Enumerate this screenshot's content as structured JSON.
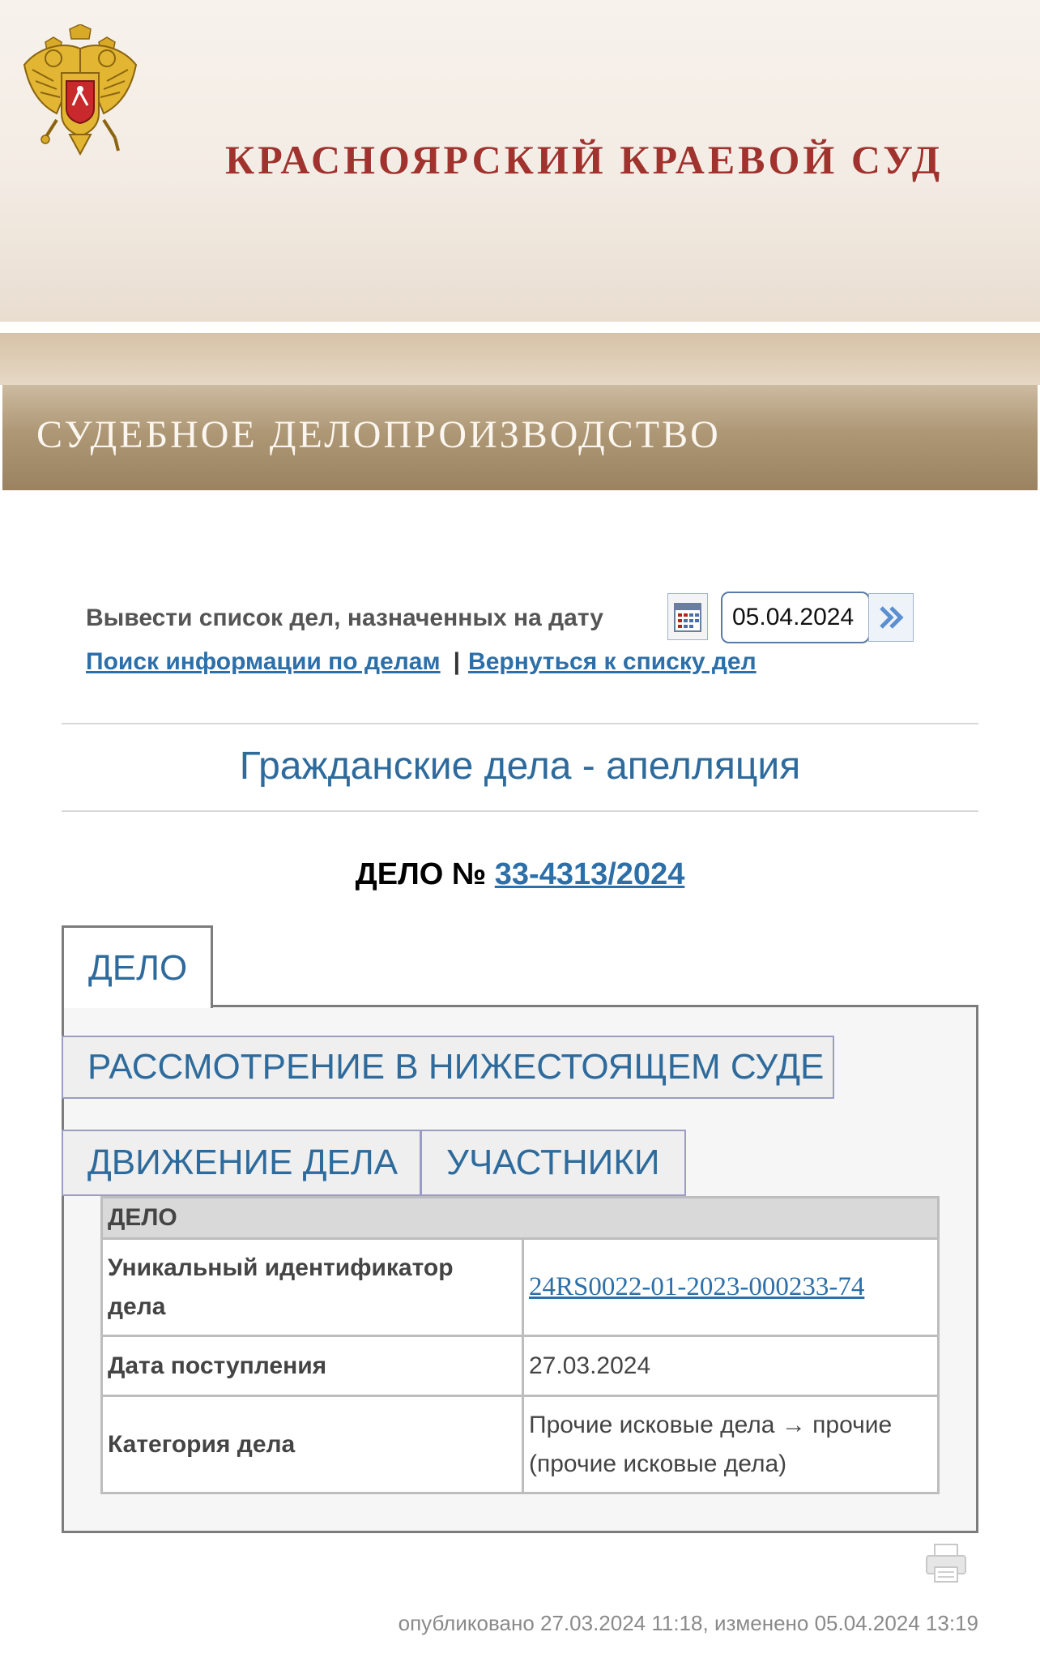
{
  "header": {
    "court_name": "КРАСНОЯРСКИЙ КРАЕВОЙ СУД"
  },
  "section": {
    "title": "СУДЕБНОЕ ДЕЛОПРОИЗВОДСТВО"
  },
  "date_filter": {
    "label": "Вывести список дел, назначенных на дату",
    "date_value": "05.04.2024"
  },
  "links": {
    "search": "Поиск информации по делам",
    "separator": "|",
    "back": "Вернуться к списку дел"
  },
  "case_type": "Гражданские дела - апелляция",
  "case": {
    "prefix": "ДЕЛО №",
    "number": "33-4313/2024"
  },
  "tabs": {
    "case": "ДЕЛО",
    "lower_court": "РАССМОТРЕНИЕ В НИЖЕСТОЯЩЕМ СУДЕ",
    "movement": "ДВИЖЕНИЕ ДЕЛА",
    "participants": "УЧАСТНИКИ"
  },
  "table": {
    "header": "ДЕЛО",
    "rows": [
      {
        "label": "Уникальный идентификатор дела",
        "value": "24RS0022-01-2023-000233-74"
      },
      {
        "label": "Дата поступления",
        "value": "27.03.2024"
      },
      {
        "label": "Категория дела",
        "value": "Прочие исковые дела → прочие (прочие исковые дела)"
      }
    ]
  },
  "footer": {
    "published": "опубликовано 27.03.2024 11:18, изменено 05.04.2024 13:19"
  },
  "icons": [
    "coat-of-arms-icon",
    "calendar-icon",
    "go-arrow-icon",
    "printer-icon"
  ],
  "colors": {
    "court_title": "#a0332e",
    "link": "#2d6fa8",
    "heading_blue": "#2e6b9c",
    "section_bar": "#ad9775"
  }
}
